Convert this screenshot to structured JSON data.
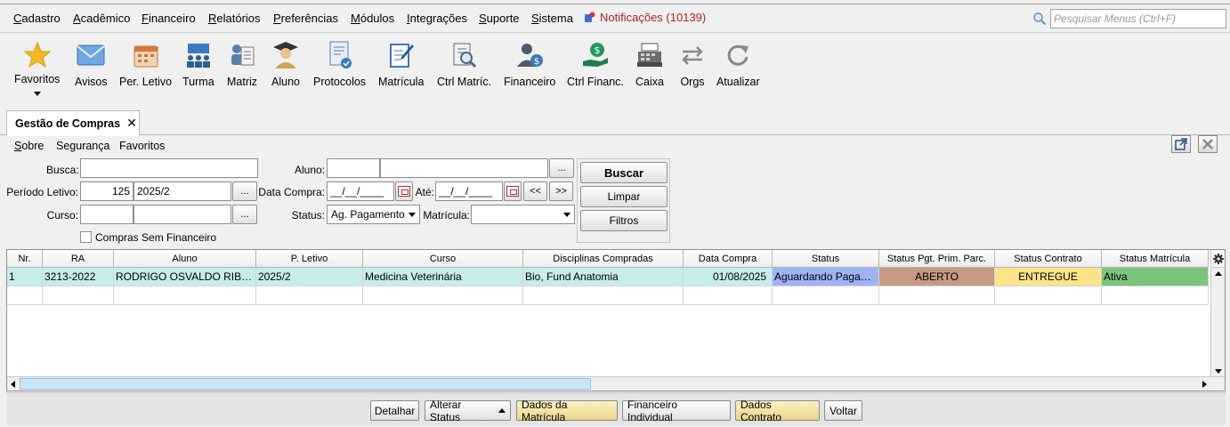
{
  "menu": {
    "items": [
      {
        "first": "C",
        "rest": "adastro"
      },
      {
        "first": "A",
        "rest": "cadêmico"
      },
      {
        "first": "F",
        "rest": "inanceiro"
      },
      {
        "first": "R",
        "rest": "elatórios"
      },
      {
        "first": "P",
        "rest": "referências"
      },
      {
        "first": "M",
        "rest": "ódulos"
      },
      {
        "first": "I",
        "rest": "ntegrações"
      },
      {
        "first": "S",
        "rest": "uporte"
      },
      {
        "first": "S",
        "rest": "istema"
      }
    ],
    "notifications": "Notificações (10139)",
    "search_placeholder": "Pesquisar Menus (Ctrl+F)"
  },
  "toolbar": {
    "items": [
      "Favoritos",
      "Avisos",
      "Per. Letivo",
      "Turma",
      "Matriz",
      "Aluno",
      "Protocolos",
      "Matrícula",
      "Ctrl Matríc.",
      "Financeiro",
      "Ctrl Financ.",
      "Caixa",
      "Orgs",
      "Atualizar"
    ]
  },
  "tab": {
    "title": "Gestão de Compras",
    "close": "✕"
  },
  "submenu": {
    "sobre_first": "S",
    "sobre_rest": "obre",
    "seguranca": "Segurança",
    "favoritos": "Favoritos"
  },
  "form": {
    "busca_label": "Busca:",
    "aluno_label": "Aluno:",
    "periodo_label": "Período Letivo:",
    "periodo_code": "125",
    "periodo_value": "2025/2",
    "data_compra_label": "Data Compra:",
    "date_placeholder": "__/__/____",
    "ate_label": "Até:",
    "curso_label": "Curso:",
    "status_label": "Status:",
    "status_value": "Ag. Pagamento",
    "matricula_label": "Matrícula:",
    "ellipsis": "...",
    "prev": "<<",
    "next": ">>",
    "checkbox_label": "Compras Sem Financeiro",
    "buscar": "Buscar",
    "limpar": "Limpar",
    "filtros": "Filtros"
  },
  "grid": {
    "headers": [
      "Nr.",
      "RA",
      "Aluno",
      "P. Letivo",
      "Curso",
      "Disciplinas Compradas",
      "Data Compra",
      "Status",
      "Status Pgt. Prim. Parc.",
      "Status Contrato",
      "Status Matrícula"
    ],
    "rows": [
      [
        "1",
        "3213-2022",
        "RODRIGO OSVALDO RIBEIRO",
        "2025/2",
        "Medicina Veterinária",
        "Bio, Fund Anatomia",
        "01/08/2025",
        "Aguardando Pagamento",
        "ABERTO",
        "ENTREGUE",
        "Ativa"
      ]
    ],
    "colors": {
      "status": "#9db3f5",
      "pgt": "#c69a84",
      "contrato": "#fbe38a",
      "matricula": "#7cc47c"
    }
  },
  "bottom": {
    "detalhar": "Detalhar",
    "alterar_status": "Alterar Status",
    "dados_matricula": "Dados da Matrícula",
    "financeiro_individual": "Financeiro Individual",
    "dados_contrato": "Dados Contrato",
    "voltar": "Voltar"
  }
}
